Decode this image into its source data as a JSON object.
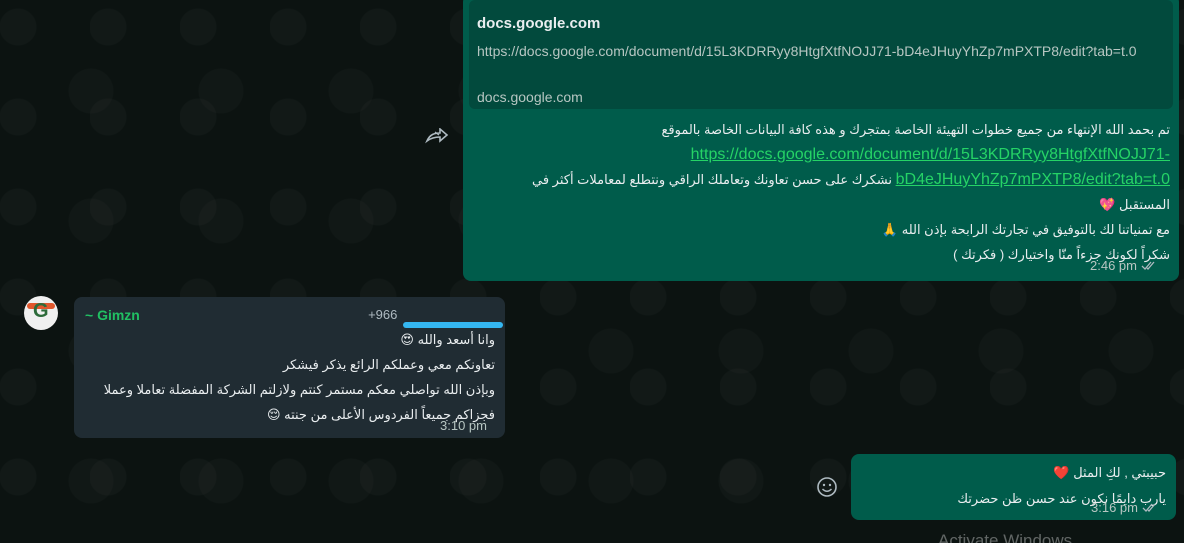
{
  "message1": {
    "link_preview": {
      "title": "docs.google.com",
      "url": "https://docs.google.com/document/d/15L3KDRRyy8HtgfXtfNOJJ71-bD4eJHuyYhZp7mPXTP8/edit?tab=t.0",
      "domain": "docs.google.com"
    },
    "line1": "تم بحمد الله الإنتهاء من جميع خطوات التهيئة الخاصة بمتجرك و هذه كافة البيانات الخاصة بالموقع",
    "link_part1": "https://docs.google.com/document/d/15L3KDRRyy8HtgfXtfNOJJ71-",
    "link_part2": "bD4eJHuyYhZp7mPXTP8/edit?tab=t.0",
    "line3": "نشكرك على حسن تعاونك وتعاملك الراقي ونتطلع لمعاملات أكثر في",
    "line4": "المستقبل 💖",
    "line5": "مع تمنياتنا لك بالتوفيق في تجارتك الرابحة بإذن الله 🙏",
    "line6": "شكراً لكونك جزءاً منّا واختيارك ( فكرتك )",
    "time": "2:46 pm"
  },
  "message2": {
    "sender": "~ Gimzn",
    "phone": "+966",
    "line1": "وانا أسعد والله 😍",
    "line2": "تعاونكم معي وعملكم الرائع يذكر فيشكر",
    "line3": "وبإذن الله تواصلي معكم مستمر كنتم ولازلتم الشركة المفضلة تعاملا وعملا",
    "line4": "فجزاكم جميعاً الفردوس الأعلى من جنته 😌",
    "time": "3:10 pm"
  },
  "message3": {
    "line1": "حبيبتي , لكِ المثل ❤️",
    "line2": "يارب دايمًا نكون عند حسن ظن حضرتك",
    "time": "3:16 pm"
  },
  "watermark": "Activate Windows",
  "colors": {
    "outgoing_bubble": "#005c4b",
    "incoming_bubble": "#202c33",
    "link_green": "#25d366",
    "background": "#0c1311"
  }
}
